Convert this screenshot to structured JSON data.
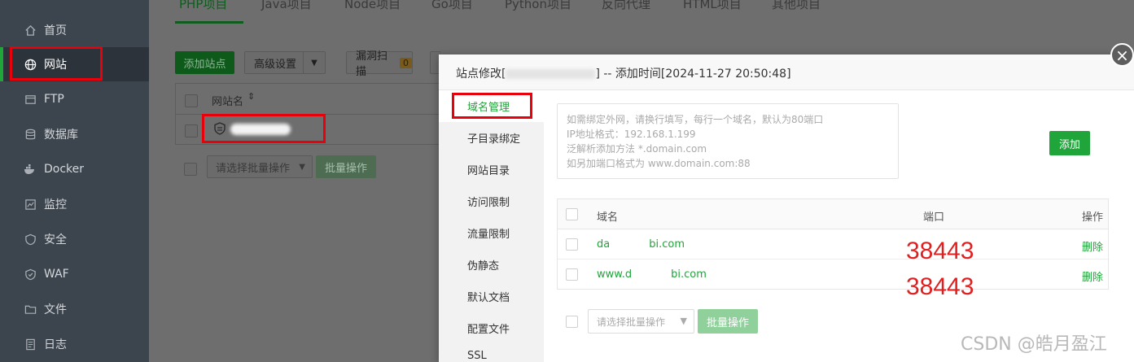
{
  "sidebar": {
    "items": [
      {
        "label": "首页",
        "icon": "home-icon"
      },
      {
        "label": "网站",
        "icon": "globe-icon"
      },
      {
        "label": "FTP",
        "icon": "ftp-icon"
      },
      {
        "label": "数据库",
        "icon": "database-icon"
      },
      {
        "label": "Docker",
        "icon": "docker-icon"
      },
      {
        "label": "监控",
        "icon": "monitor-icon"
      },
      {
        "label": "安全",
        "icon": "shield-icon"
      },
      {
        "label": "WAF",
        "icon": "waf-icon"
      },
      {
        "label": "文件",
        "icon": "folder-icon"
      },
      {
        "label": "日志",
        "icon": "log-icon"
      }
    ],
    "active": "网站"
  },
  "main": {
    "tabs": [
      "PHP项目",
      "Java项目",
      "Node项目",
      "Go项目",
      "Python项目",
      "反向代理",
      "HTML项目",
      "其他项目"
    ],
    "toolbar": {
      "add_site": "添加站点",
      "advanced": "高级设置",
      "vuln_scan": "漏洞扫描",
      "vuln_count": "0"
    },
    "table": {
      "col_sitename": "网站名"
    },
    "batch": {
      "placeholder": "请选择批量操作",
      "button": "批量操作"
    }
  },
  "modal": {
    "title_prefix": "站点修改[",
    "title_suffix": "] -- 添加时间[2024-11-27 20:50:48]",
    "side_items": [
      "域名管理",
      "子目录绑定",
      "网站目录",
      "访问限制",
      "流量限制",
      "伪静态",
      "默认文档",
      "配置文件",
      "SSL"
    ],
    "active_side": "域名管理",
    "textarea_placeholder": "如需绑定外网，请换行填写，每行一个域名，默认为80端口\nIP地址格式：192.168.1.199\n泛解析添加方法 *.domain.com\n如另加端口格式为 www.domain.com:88",
    "add_button": "添加",
    "table": {
      "headers": {
        "domain": "域名",
        "port": "端口",
        "action": "操作"
      },
      "rows": [
        {
          "domain_a": "da",
          "domain_b": "bi.com",
          "delete": "删除"
        },
        {
          "domain_a": "www.d",
          "domain_b": "bi.com",
          "delete": "删除"
        }
      ]
    },
    "batch": {
      "placeholder": "请选择批量操作",
      "button": "批量操作"
    }
  },
  "annotations": {
    "port_1": "38443",
    "port_2": "38443"
  },
  "watermark": "CSDN @皓月盈江",
  "colors": {
    "accent": "#20a53a",
    "annotation_red": "#e8000b",
    "sidebar_bg": "#3c444d"
  }
}
